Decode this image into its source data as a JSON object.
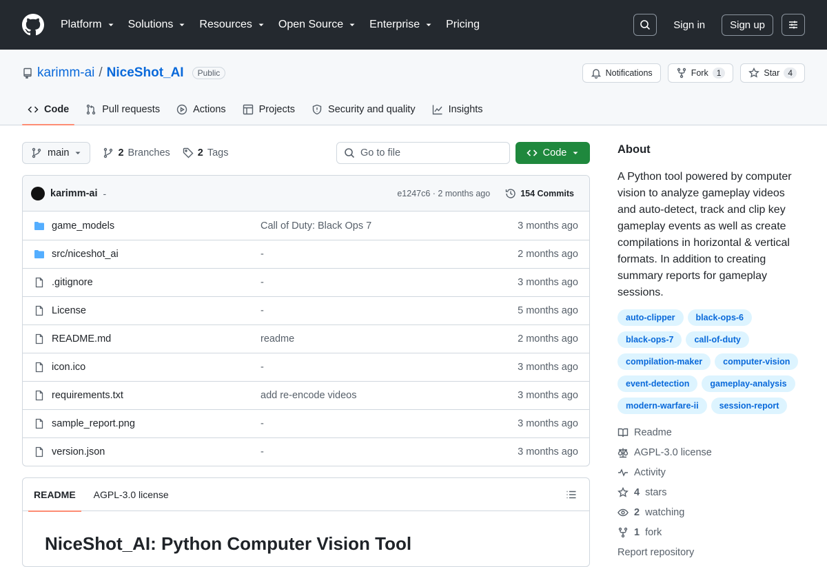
{
  "header": {
    "nav": [
      "Platform",
      "Solutions",
      "Resources",
      "Open Source",
      "Enterprise",
      "Pricing"
    ],
    "nav_has_dropdown": [
      true,
      true,
      true,
      true,
      true,
      false
    ],
    "signin": "Sign in",
    "signup": "Sign up"
  },
  "repo": {
    "owner": "karimm-ai",
    "separator": "/",
    "name": "NiceShot_AI",
    "visibility": "Public",
    "notifications": "Notifications",
    "fork_label": "Fork",
    "fork_count": "1",
    "star_label": "Star",
    "star_count": "4",
    "tabs": [
      "Code",
      "Pull requests",
      "Actions",
      "Projects",
      "Security and quality",
      "Insights"
    ]
  },
  "toolbar": {
    "branch": "main",
    "branches_count": "2",
    "branches_label": "Branches",
    "tags_count": "2",
    "tags_label": "Tags",
    "goto_placeholder": "Go to file",
    "code_button": "Code"
  },
  "commit": {
    "author": "karimm-ai",
    "dash": "-",
    "hash_time": "e1247c6 · 2 months ago",
    "commits": "154 Commits"
  },
  "files": [
    {
      "type": "dir",
      "name": "game_models",
      "message": "Call of Duty: Black Ops 7",
      "date": "3 months ago"
    },
    {
      "type": "dir",
      "name": "src/niceshot_ai",
      "message": "-",
      "date": "2 months ago"
    },
    {
      "type": "file",
      "name": ".gitignore",
      "message": "-",
      "date": "3 months ago"
    },
    {
      "type": "file",
      "name": "License",
      "message": "-",
      "date": "5 months ago"
    },
    {
      "type": "file",
      "name": "README.md",
      "message": "readme",
      "date": "2 months ago"
    },
    {
      "type": "file",
      "name": "icon.ico",
      "message": "-",
      "date": "3 months ago"
    },
    {
      "type": "file",
      "name": "requirements.txt",
      "message": "add re-encode videos",
      "date": "3 months ago"
    },
    {
      "type": "file",
      "name": "sample_report.png",
      "message": "-",
      "date": "3 months ago"
    },
    {
      "type": "file",
      "name": "version.json",
      "message": "-",
      "date": "3 months ago"
    }
  ],
  "readme": {
    "tab_readme": "README",
    "tab_license": "AGPL-3.0 license",
    "heading": "NiceShot_AI: Python Computer Vision Tool"
  },
  "about": {
    "title": "About",
    "description": "A Python tool powered by computer vision to analyze gameplay videos and auto-detect, track and clip key gameplay events as well as create compilations in horizontal & vertical formats. In addition to creating summary reports for gameplay sessions.",
    "topics": [
      "auto-clipper",
      "black-ops-6",
      "black-ops-7",
      "call-of-duty",
      "compilation-maker",
      "computer-vision",
      "event-detection",
      "gameplay-analysis",
      "modern-warfare-ii",
      "session-report"
    ],
    "links": {
      "readme": "Readme",
      "license": "AGPL-3.0 license",
      "activity": "Activity",
      "stars_count": "4",
      "stars_label": "stars",
      "watching_count": "2",
      "watching_label": "watching",
      "forks_count": "1",
      "forks_label": "fork",
      "report": "Report repository"
    }
  }
}
